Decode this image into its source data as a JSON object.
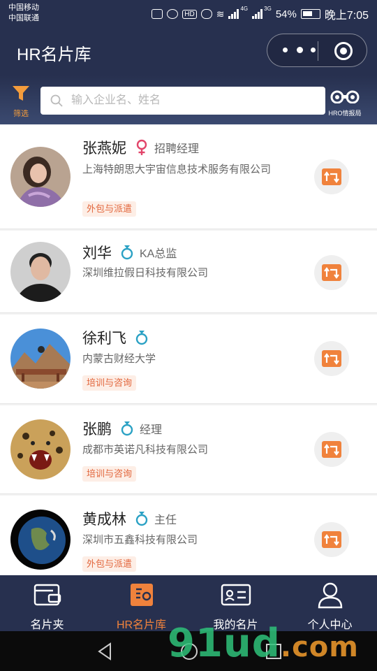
{
  "status_bar": {
    "carrier_1": "中国移动",
    "carrier_2": "中国联通",
    "net_label": "HD",
    "gen_4g": "4G",
    "gen_3g": "3G",
    "battery": "54%",
    "time": "晚上7:05"
  },
  "header": {
    "title": "HR名片库"
  },
  "search": {
    "filter_label": "筛选",
    "placeholder": "输入企业名、姓名",
    "hro_label": "HRO情报局"
  },
  "contacts": [
    {
      "name": "张燕妮",
      "gender": "female",
      "title": "招聘经理",
      "company": "上海特朗思大宇宙信息技术服务有限公司",
      "tag": "外包与派遣"
    },
    {
      "name": "刘华",
      "gender": "male",
      "title": "KA总监",
      "company": "深圳维拉假日科技有限公司",
      "tag": ""
    },
    {
      "name": "徐利飞",
      "gender": "male",
      "title": "",
      "company": "内蒙古财经大学",
      "tag": "培训与咨询"
    },
    {
      "name": "张鹏",
      "gender": "male",
      "title": "经理",
      "company": "成都市英诺凡科技有限公司",
      "tag": "培训与咨询"
    },
    {
      "name": "黄成林",
      "gender": "male",
      "title": "主任",
      "company": "深圳市五鑫科技有限公司",
      "tag": "外包与派遣"
    }
  ],
  "tabs": [
    {
      "label": "名片夹",
      "icon": "card-holder-icon",
      "active": false
    },
    {
      "label": "HR名片库",
      "icon": "hr-library-icon",
      "active": true
    },
    {
      "label": "我的名片",
      "icon": "my-card-icon",
      "active": false
    },
    {
      "label": "个人中心",
      "icon": "person-icon",
      "active": false
    }
  ],
  "watermark": {
    "text_main": "91ud",
    "text_suffix": ".com"
  },
  "colors": {
    "header_bg": "#27304f",
    "accent": "#f0823c",
    "male": "#2aa1c4",
    "female": "#e2456a",
    "tag_text": "#e2663c",
    "tag_bg": "#fdeee6"
  }
}
